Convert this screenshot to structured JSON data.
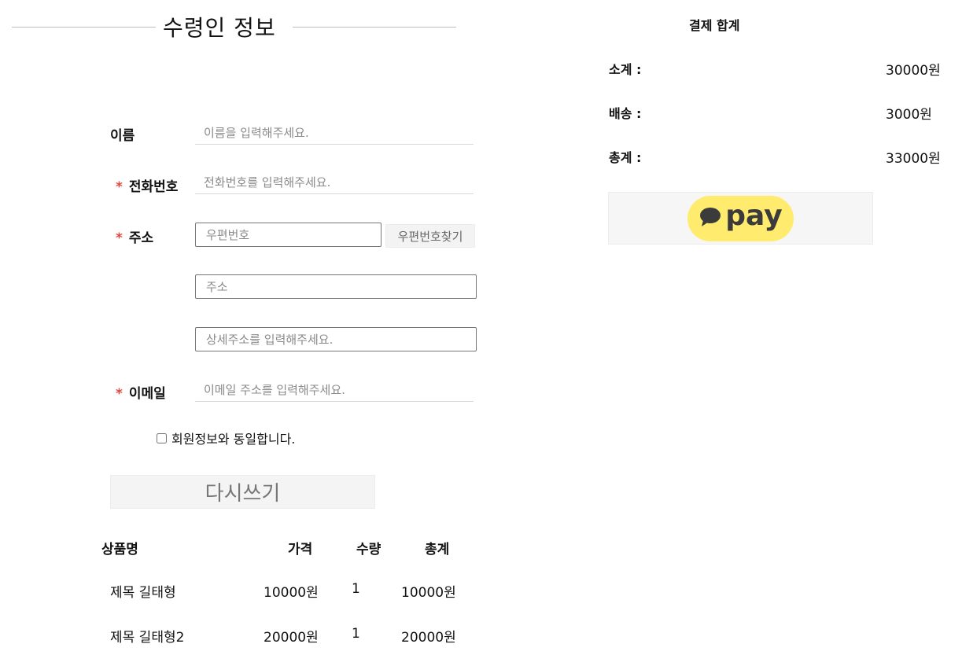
{
  "recipient": {
    "title": "수령인 정보",
    "name": {
      "label": "이름",
      "placeholder": "이름을 입력해주세요."
    },
    "phone": {
      "required_mark": "*",
      "label": "전화번호",
      "placeholder": "전화번호를 입력해주세요."
    },
    "address": {
      "required_mark": "*",
      "label": "주소",
      "zip_placeholder": "우편번호",
      "zip_button": "우편번호찾기",
      "address_placeholder": "주소",
      "detail_placeholder": "상세주소를 입력해주세요."
    },
    "email": {
      "required_mark": "*",
      "label": "이메일",
      "placeholder": "이메일 주소를 입력해주세요."
    },
    "same_as_member_label": "회원정보와 동일합니다.",
    "reset_button": "다시쓰기"
  },
  "products": {
    "headers": {
      "name": "상품명",
      "price": "가격",
      "quantity": "수량",
      "total": "총계"
    },
    "rows": [
      {
        "name": "제목 길태형",
        "price": "10000원",
        "quantity": "1",
        "total": "10000원"
      },
      {
        "name": "제목 길태형2",
        "price": "20000원",
        "quantity": "1",
        "total": "20000원"
      }
    ]
  },
  "summary": {
    "title": "결제 합계",
    "subtotal": {
      "label": "소계 :",
      "value": "30000원"
    },
    "shipping": {
      "label": "배송 :",
      "value": "3000원"
    },
    "total": {
      "label": "총계 :",
      "value": "33000원"
    },
    "pay_button": {
      "icon": "speech-bubble-icon",
      "label": "pay",
      "bg_color": "#ffeb6e"
    }
  },
  "colors": {
    "required": "#e0483f"
  }
}
